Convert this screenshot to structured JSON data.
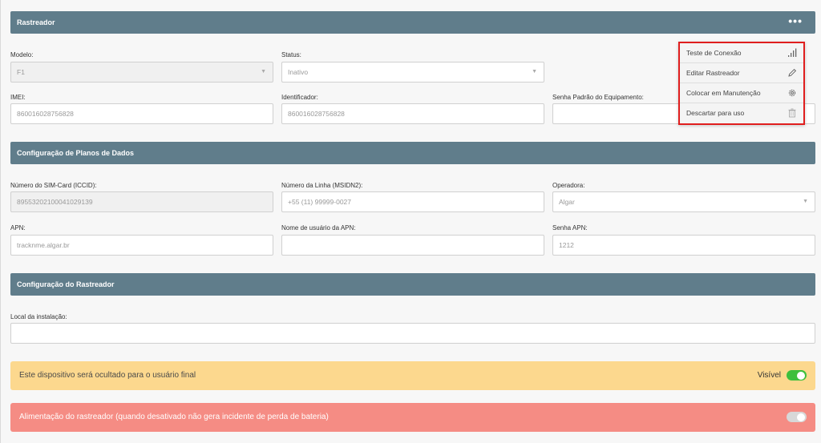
{
  "header": {
    "title": "Rastreador",
    "more": "•••"
  },
  "fields": {
    "modelo": {
      "label": "Modelo:",
      "value": "F1"
    },
    "status": {
      "label": "Status:",
      "value": "Inativo"
    },
    "imei": {
      "label": "IMEI:",
      "value": "860016028756828"
    },
    "identificador": {
      "label": "Identificador:",
      "value": "860016028756828"
    },
    "senha_padrao": {
      "label": "Senha Padrão do Equipamento:",
      "value": ""
    }
  },
  "planos": {
    "title": "Configuração de Planos de Dados",
    "iccid": {
      "label": "Número do SIM-Card (ICCID):",
      "value": "89553202100041029139"
    },
    "msisdn": {
      "label": "Número da Linha (MSIDN2):",
      "placeholder": "+55 (11) 99999-0027"
    },
    "operadora": {
      "label": "Operadora:",
      "value": "Algar"
    },
    "apn": {
      "label": "APN:",
      "value": "tracknme.algar.br"
    },
    "apn_user": {
      "label": "Nome de usuário da APN:",
      "value": ""
    },
    "apn_pass": {
      "label": "Senha APN:",
      "value": "1212"
    }
  },
  "rastreador_cfg": {
    "title": "Configuração do Rastreador",
    "local": {
      "label": "Local da instalação:",
      "value": ""
    }
  },
  "menu": {
    "items": [
      {
        "label": "Teste de Conexão",
        "icon": "signal-icon"
      },
      {
        "label": "Editar Rastreador",
        "icon": "pencil-icon"
      },
      {
        "label": "Colocar em Manutenção",
        "icon": "gear-icon"
      },
      {
        "label": "Descartar para uso",
        "icon": "trash-icon"
      }
    ],
    "highlight_color": "#e01e1e"
  },
  "banners": {
    "visibility": {
      "text": "Este dispositivo será ocultado para o usuário final",
      "toggle_label": "Visível",
      "state": "on"
    },
    "power": {
      "text": "Alimentação do rastreador (quando desativado não gera incidente de perda de bateria)",
      "state": "off"
    }
  },
  "colors": {
    "section": "#607d8b",
    "warn": "#fcd88e",
    "danger": "#f58c84",
    "toggle_on": "#3dbf3d"
  }
}
